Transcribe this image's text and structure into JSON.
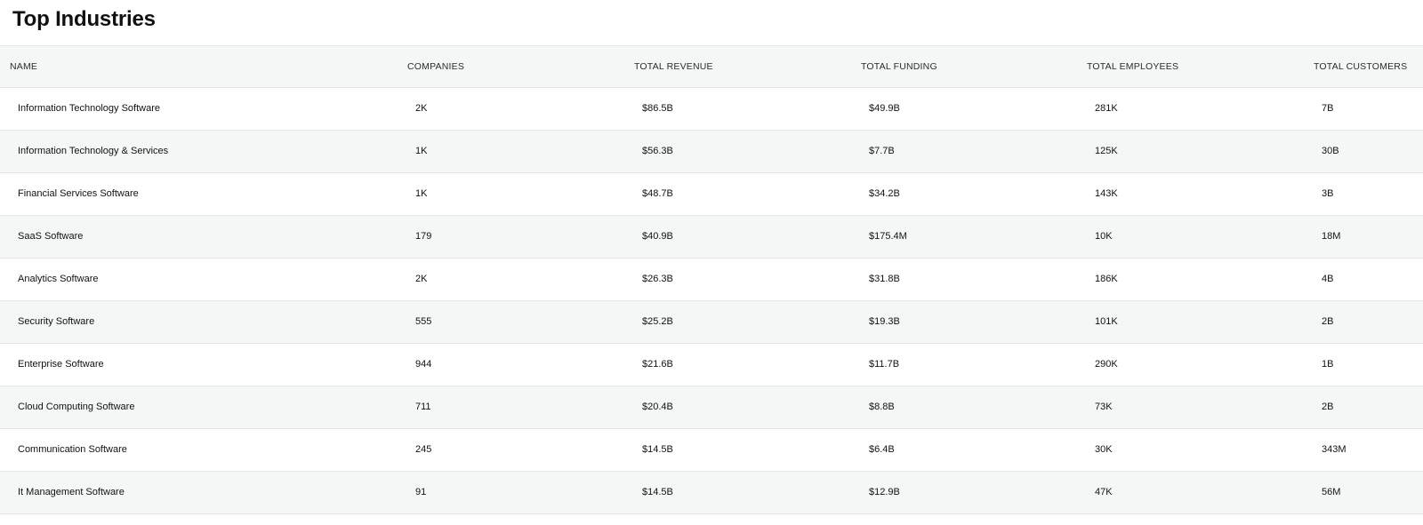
{
  "page": {
    "title": "Top Industries"
  },
  "table": {
    "columns": [
      "NAME",
      "COMPANIES",
      "TOTAL REVENUE",
      "TOTAL FUNDING",
      "TOTAL EMPLOYEES",
      "TOTAL CUSTOMERS"
    ],
    "rows": [
      [
        "Information Technology Software",
        "2K",
        "$86.5B",
        "$49.9B",
        "281K",
        "7B"
      ],
      [
        "Information Technology & Services",
        "1K",
        "$56.3B",
        "$7.7B",
        "125K",
        "30B"
      ],
      [
        "Financial Services Software",
        "1K",
        "$48.7B",
        "$34.2B",
        "143K",
        "3B"
      ],
      [
        "SaaS Software",
        "179",
        "$40.9B",
        "$175.4M",
        "10K",
        "18M"
      ],
      [
        "Analytics Software",
        "2K",
        "$26.3B",
        "$31.8B",
        "186K",
        "4B"
      ],
      [
        "Security Software",
        "555",
        "$25.2B",
        "$19.3B",
        "101K",
        "2B"
      ],
      [
        "Enterprise Software",
        "944",
        "$21.6B",
        "$11.7B",
        "290K",
        "1B"
      ],
      [
        "Cloud Computing Software",
        "711",
        "$20.4B",
        "$8.8B",
        "73K",
        "2B"
      ],
      [
        "Communication Software",
        "245",
        "$14.5B",
        "$6.4B",
        "30K",
        "343M"
      ],
      [
        "It Management Software",
        "91",
        "$14.5B",
        "$12.9B",
        "47K",
        "56M"
      ]
    ]
  }
}
